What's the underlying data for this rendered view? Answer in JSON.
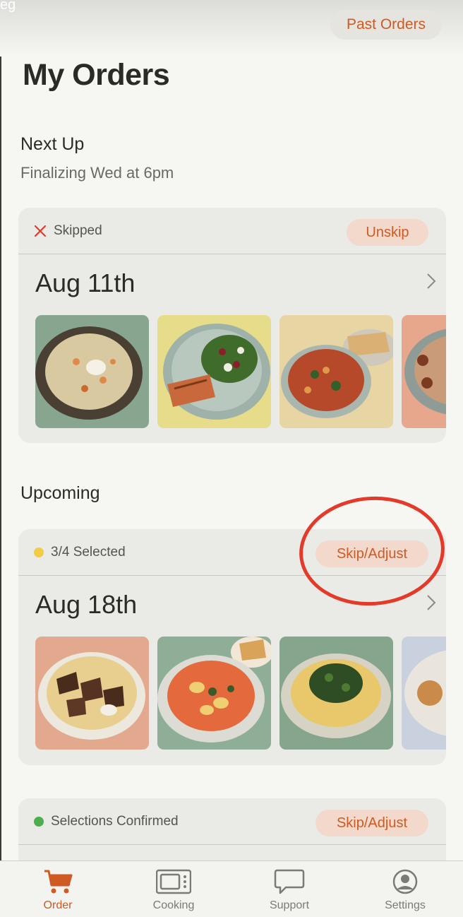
{
  "corner_text": "eg",
  "header": {
    "past_orders_label": "Past Orders"
  },
  "page_title": "My Orders",
  "next_up": {
    "heading": "Next Up",
    "subtitle": "Finalizing Wed at 6pm",
    "card": {
      "status_text": "Skipped",
      "status_icon": "close-icon",
      "action_label": "Unskip",
      "date": "Aug 11th",
      "meals": [
        "risotto-bowl",
        "salmon-kale-salad",
        "tomato-stew-flatbread",
        "pasta-bowl"
      ]
    }
  },
  "upcoming": {
    "heading": "Upcoming",
    "cards": [
      {
        "status_text": "3/4 Selected",
        "status_color": "#f2cc45",
        "action_label": "Skip/Adjust",
        "date": "Aug 18th",
        "meals": [
          "beef-stroganoff",
          "tortellini-soup",
          "greens-polenta",
          "plated-dish"
        ]
      },
      {
        "status_text": "Selections Confirmed",
        "status_color": "#4cae4c",
        "action_label": "Skip/Adjust"
      }
    ]
  },
  "tabbar": {
    "items": [
      {
        "label": "Order",
        "icon": "cart-icon",
        "active": true
      },
      {
        "label": "Cooking",
        "icon": "microwave-icon",
        "active": false
      },
      {
        "label": "Support",
        "icon": "chat-bubble-icon",
        "active": false
      },
      {
        "label": "Settings",
        "icon": "user-circle-icon",
        "active": false
      }
    ]
  },
  "colors": {
    "accent": "#cf5a23",
    "pill_bg": "#f2d9cb",
    "annotation_circle": "#e33a2a"
  }
}
